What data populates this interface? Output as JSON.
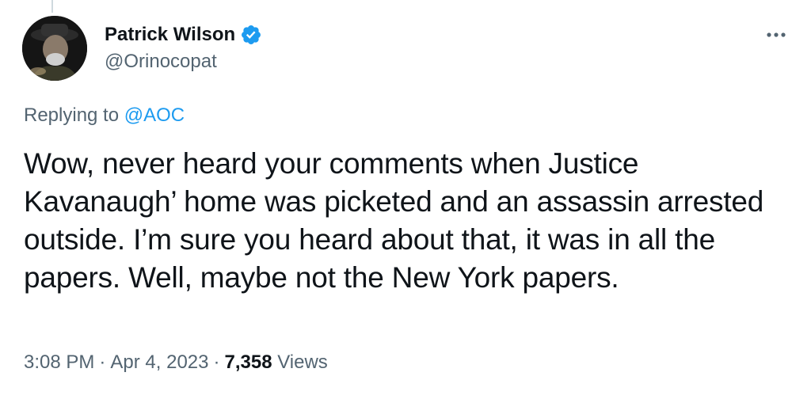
{
  "author": {
    "display_name": "Patrick Wilson",
    "handle": "@Orinocopat",
    "verified": true,
    "avatar_icon": "profile-photo-man-in-hat"
  },
  "reply": {
    "prefix": "Replying to ",
    "to_handle": "@AOC"
  },
  "tweet": {
    "text": "Wow, never heard your comments when Justice Kavanaugh’ home was picketed and an assassin arrested outside. I’m sure you heard about that, it was in all the papers.  Well, maybe not the New York papers."
  },
  "meta": {
    "time": "3:08 PM",
    "separator": "·",
    "date": "Apr 4, 2023",
    "views_count": "7,358",
    "views_label": "Views"
  },
  "colors": {
    "accent": "#1d9bf0",
    "secondary_text": "#536471",
    "primary_text": "#0f1419"
  },
  "icons": {
    "more": "more-horizontal-icon",
    "verified": "verified-badge-icon"
  }
}
